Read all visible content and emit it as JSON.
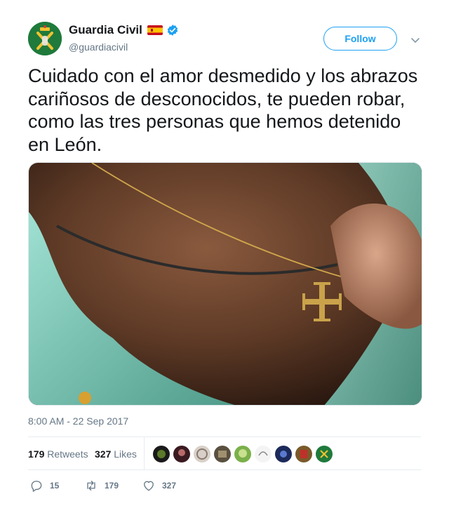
{
  "account": {
    "name": "Guardia Civil",
    "handle": "@guardiacivil",
    "follow_label": "Follow",
    "avatar_icon": "guardia-civil-emblem-icon",
    "flag_icon": "spain-flag-icon",
    "verified_icon": "verified-badge-icon"
  },
  "tweet": {
    "text": "Cuidado con el amor desmedido y los abrazos cariñosos de desconocidos, te pueden robar, como las tres personas que hemos detenido en León.",
    "timestamp": "8:00 AM - 22 Sep 2017"
  },
  "stats": {
    "retweets_count": "179",
    "retweets_label": "Retweets",
    "likes_count": "327",
    "likes_label": "Likes"
  },
  "actions": {
    "reply_count": "15",
    "retweet_count": "179",
    "like_count": "327"
  },
  "colors": {
    "accent": "#1da1f2",
    "text": "#14171a",
    "muted": "#657786",
    "avatar_green": "#1f7a3c"
  }
}
